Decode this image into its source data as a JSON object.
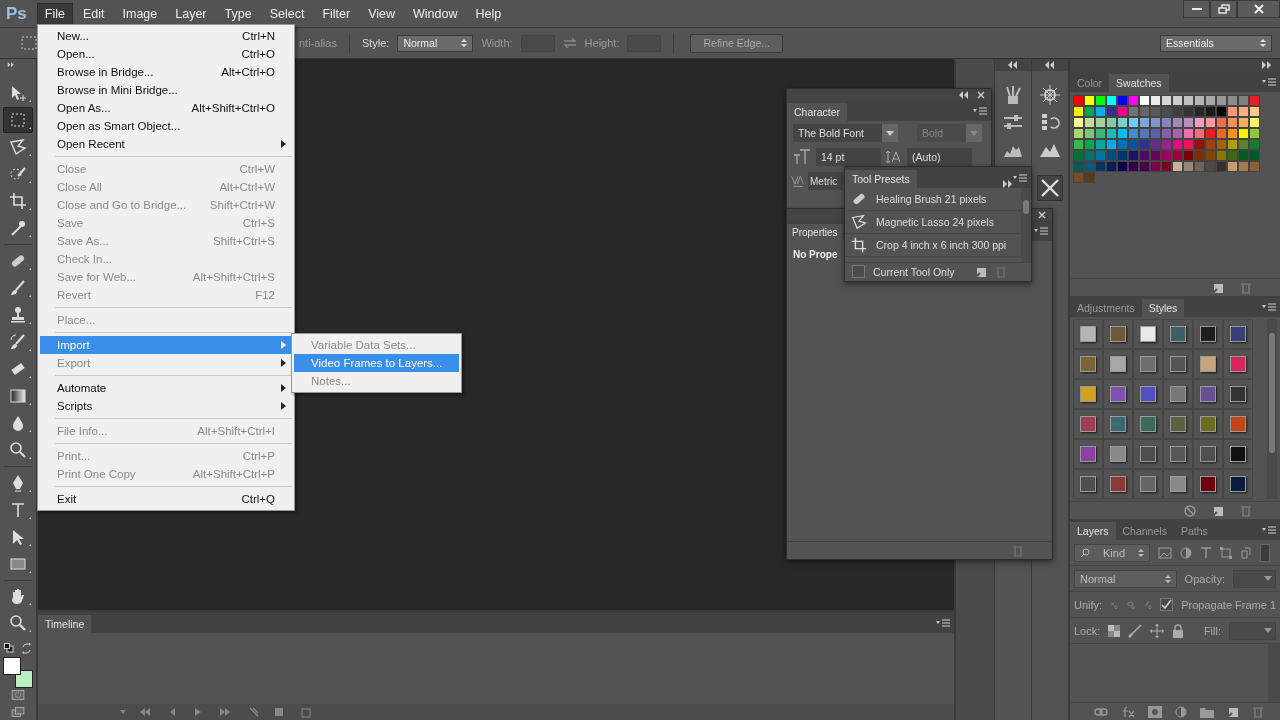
{
  "app": {
    "logo": "Ps"
  },
  "menubar": [
    {
      "label": "File",
      "selected": true
    },
    {
      "label": "Edit",
      "selected": false
    },
    {
      "label": "Image",
      "selected": false
    },
    {
      "label": "Layer",
      "selected": false
    },
    {
      "label": "Type",
      "selected": false
    },
    {
      "label": "Select",
      "selected": false
    },
    {
      "label": "Filter",
      "selected": false
    },
    {
      "label": "View",
      "selected": false
    },
    {
      "label": "Window",
      "selected": false
    },
    {
      "label": "Help",
      "selected": false
    }
  ],
  "options_bar": {
    "antialias_label": "nti-alias",
    "style_label": "Style:",
    "style_value": "Normal",
    "width_label": "Width:",
    "height_label": "Height:",
    "refine_button": "Refine Edge...",
    "workspace": "Essentials"
  },
  "tool_groups": [
    {
      "tools": [
        {
          "kind": "move",
          "selected": false
        },
        {
          "kind": "marquee",
          "selected": true
        },
        {
          "kind": "lasso",
          "selected": false
        },
        {
          "kind": "quick-select",
          "selected": false
        },
        {
          "kind": "crop",
          "selected": false
        },
        {
          "kind": "eyedropper",
          "selected": false
        }
      ]
    },
    {
      "tools": [
        {
          "kind": "healing",
          "selected": false
        },
        {
          "kind": "brush",
          "selected": false
        },
        {
          "kind": "stamp",
          "selected": false
        },
        {
          "kind": "history-brush",
          "selected": false
        },
        {
          "kind": "eraser",
          "selected": false
        },
        {
          "kind": "gradient",
          "selected": false
        },
        {
          "kind": "blur",
          "selected": false
        },
        {
          "kind": "dodge",
          "selected": false
        }
      ]
    },
    {
      "tools": [
        {
          "kind": "pen",
          "selected": false
        },
        {
          "kind": "type",
          "selected": false
        },
        {
          "kind": "path-select",
          "selected": false
        },
        {
          "kind": "rectangle",
          "selected": false
        }
      ]
    },
    {
      "tools": [
        {
          "kind": "hand",
          "selected": false
        },
        {
          "kind": "zoom",
          "selected": false
        }
      ]
    }
  ],
  "color_chips": [
    {
      "kind": "foreground",
      "color": "#ffffff"
    },
    {
      "kind": "background",
      "color": "#b8f0c2"
    }
  ],
  "file_menu": [
    {
      "kind": "item",
      "label": "New...",
      "shortcut": "Ctrl+N",
      "submenu": false,
      "disabled": false,
      "selected": false
    },
    {
      "kind": "item",
      "label": "Open...",
      "shortcut": "Ctrl+O",
      "submenu": false,
      "disabled": false,
      "selected": false
    },
    {
      "kind": "item",
      "label": "Browse in Bridge...",
      "shortcut": "Alt+Ctrl+O",
      "submenu": false,
      "disabled": false,
      "selected": false
    },
    {
      "kind": "item",
      "label": "Browse in Mini Bridge...",
      "submenu": false,
      "disabled": false,
      "selected": false
    },
    {
      "kind": "item",
      "label": "Open As...",
      "shortcut": "Alt+Shift+Ctrl+O",
      "submenu": false,
      "disabled": false,
      "selected": false
    },
    {
      "kind": "item",
      "label": "Open as Smart Object...",
      "submenu": false,
      "disabled": false,
      "selected": false
    },
    {
      "kind": "item",
      "label": "Open Recent",
      "submenu": true,
      "disabled": false,
      "selected": false
    },
    {
      "kind": "separator"
    },
    {
      "kind": "item",
      "label": "Close",
      "shortcut": "Ctrl+W",
      "submenu": false,
      "disabled": true,
      "selected": false
    },
    {
      "kind": "item",
      "label": "Close All",
      "shortcut": "Alt+Ctrl+W",
      "submenu": false,
      "disabled": true,
      "selected": false
    },
    {
      "kind": "item",
      "label": "Close and Go to Bridge...",
      "shortcut": "Shift+Ctrl+W",
      "submenu": false,
      "disabled": true,
      "selected": false
    },
    {
      "kind": "item",
      "label": "Save",
      "shortcut": "Ctrl+S",
      "submenu": false,
      "disabled": true,
      "selected": false
    },
    {
      "kind": "item",
      "label": "Save As...",
      "shortcut": "Shift+Ctrl+S",
      "submenu": false,
      "disabled": true,
      "selected": false
    },
    {
      "kind": "item",
      "label": "Check In...",
      "submenu": false,
      "disabled": true,
      "selected": false
    },
    {
      "kind": "item",
      "label": "Save for Web...",
      "shortcut": "Alt+Shift+Ctrl+S",
      "submenu": false,
      "disabled": true,
      "selected": false
    },
    {
      "kind": "item",
      "label": "Revert",
      "shortcut": "F12",
      "submenu": false,
      "disabled": true,
      "selected": false
    },
    {
      "kind": "separator"
    },
    {
      "kind": "item",
      "label": "Place...",
      "submenu": false,
      "disabled": true,
      "selected": false
    },
    {
      "kind": "separator"
    },
    {
      "kind": "item",
      "label": "Import",
      "submenu": true,
      "disabled": false,
      "selected": true
    },
    {
      "kind": "item",
      "label": "Export",
      "submenu": true,
      "disabled": true,
      "selected": false
    },
    {
      "kind": "separator"
    },
    {
      "kind": "item",
      "label": "Automate",
      "submenu": true,
      "disabled": false,
      "selected": false
    },
    {
      "kind": "item",
      "label": "Scripts",
      "submenu": true,
      "disabled": false,
      "selected": false
    },
    {
      "kind": "separator"
    },
    {
      "kind": "item",
      "label": "File Info...",
      "shortcut": "Alt+Shift+Ctrl+I",
      "submenu": false,
      "disabled": true,
      "selected": false
    },
    {
      "kind": "separator"
    },
    {
      "kind": "item",
      "label": "Print...",
      "shortcut": "Ctrl+P",
      "submenu": false,
      "disabled": true,
      "selected": false
    },
    {
      "kind": "item",
      "label": "Print One Copy",
      "shortcut": "Alt+Shift+Ctrl+P",
      "submenu": false,
      "disabled": true,
      "selected": false
    },
    {
      "kind": "separator"
    },
    {
      "kind": "item",
      "label": "Exit",
      "shortcut": "Ctrl+Q",
      "submenu": false,
      "disabled": false,
      "selected": false
    }
  ],
  "import_submenu": [
    {
      "label": "Variable Data Sets...",
      "disabled": true,
      "selected": false
    },
    {
      "label": "Video Frames to Layers...",
      "disabled": false,
      "selected": true
    },
    {
      "label": "Notes...",
      "disabled": true,
      "selected": false
    }
  ],
  "character_panel": {
    "tab": "Character",
    "font_family": "The Bold Font",
    "font_style": "Bold",
    "size": "14 pt",
    "leading": "(Auto)",
    "kerning": "Metric"
  },
  "properties_panel": {
    "tab": "Properties",
    "message": "No Prope"
  },
  "tool_presets": {
    "tab": "Tool Presets",
    "items": [
      {
        "kind": "healing",
        "label": "Healing Brush 21 pixels"
      },
      {
        "kind": "lasso",
        "label": "Magnetic Lasso 24 pixels"
      },
      {
        "kind": "crop",
        "label": "Crop 4 inch x 6 inch 300 ppi"
      }
    ],
    "current_tool_only": {
      "label": "Current Tool Only",
      "checked": false
    }
  },
  "swatches_panel": {
    "tabs": [
      {
        "label": "Color",
        "selected": false
      },
      {
        "label": "Swatches",
        "selected": true
      }
    ],
    "swatches": [
      {
        "color": "#ff0000"
      },
      {
        "color": "#ffff00"
      },
      {
        "color": "#00ff00"
      },
      {
        "color": "#00ffff"
      },
      {
        "color": "#0000ff"
      },
      {
        "color": "#ff00ff"
      },
      {
        "color": "#ffffff"
      },
      {
        "color": "#ebebeb"
      },
      {
        "color": "#d6d6d6"
      },
      {
        "color": "#cccccc"
      },
      {
        "color": "#c0c0c0"
      },
      {
        "color": "#b3b3b3"
      },
      {
        "color": "#a6a6a6"
      },
      {
        "color": "#999999"
      },
      {
        "color": "#8c8c8c"
      },
      {
        "color": "#808080"
      },
      {
        "color": "#ed1c24"
      },
      {
        "color": "#fff200"
      },
      {
        "color": "#00a650"
      },
      {
        "color": "#00aeef"
      },
      {
        "color": "#2e3192"
      },
      {
        "color": "#ec008c"
      },
      {
        "color": "#737373"
      },
      {
        "color": "#666666"
      },
      {
        "color": "#595959"
      },
      {
        "color": "#4d4d4d"
      },
      {
        "color": "#404040"
      },
      {
        "color": "#333333"
      },
      {
        "color": "#262626"
      },
      {
        "color": "#1a1a1a"
      },
      {
        "color": "#000000"
      },
      {
        "color": "#f7977a"
      },
      {
        "color": "#f9ad81"
      },
      {
        "color": "#fdc68a"
      },
      {
        "color": "#fff79a"
      },
      {
        "color": "#c4df9b"
      },
      {
        "color": "#a3d39c"
      },
      {
        "color": "#82ca9d"
      },
      {
        "color": "#7bcdc8"
      },
      {
        "color": "#6ecff6"
      },
      {
        "color": "#7ea7d8"
      },
      {
        "color": "#8493ca"
      },
      {
        "color": "#8882be"
      },
      {
        "color": "#a187be"
      },
      {
        "color": "#bc8dbf"
      },
      {
        "color": "#f49ac2"
      },
      {
        "color": "#f6989d"
      },
      {
        "color": "#f26c4f"
      },
      {
        "color": "#f68e55"
      },
      {
        "color": "#fbaf5c"
      },
      {
        "color": "#fff467"
      },
      {
        "color": "#acd372"
      },
      {
        "color": "#7cc576"
      },
      {
        "color": "#3bb878"
      },
      {
        "color": "#1abbb4"
      },
      {
        "color": "#00bff3"
      },
      {
        "color": "#438ccb"
      },
      {
        "color": "#5574b9"
      },
      {
        "color": "#605ca8"
      },
      {
        "color": "#855fa8"
      },
      {
        "color": "#a763a8"
      },
      {
        "color": "#f06ea9"
      },
      {
        "color": "#f26d7d"
      },
      {
        "color": "#ed1c24"
      },
      {
        "color": "#f26522"
      },
      {
        "color": "#f7941d"
      },
      {
        "color": "#fff200"
      },
      {
        "color": "#8dc63f"
      },
      {
        "color": "#39b54a"
      },
      {
        "color": "#00a651"
      },
      {
        "color": "#00a99d"
      },
      {
        "color": "#00aeef"
      },
      {
        "color": "#0072bc"
      },
      {
        "color": "#0054a6"
      },
      {
        "color": "#2e3192"
      },
      {
        "color": "#662d91"
      },
      {
        "color": "#92278f"
      },
      {
        "color": "#ec008c"
      },
      {
        "color": "#ed145b"
      },
      {
        "color": "#9e0b0f"
      },
      {
        "color": "#a0410d"
      },
      {
        "color": "#a36209"
      },
      {
        "color": "#aba000"
      },
      {
        "color": "#598527"
      },
      {
        "color": "#197b30"
      },
      {
        "color": "#007236"
      },
      {
        "color": "#00746b"
      },
      {
        "color": "#0076a3"
      },
      {
        "color": "#004b80"
      },
      {
        "color": "#003471"
      },
      {
        "color": "#1b1464"
      },
      {
        "color": "#440e62"
      },
      {
        "color": "#630460"
      },
      {
        "color": "#9e005d"
      },
      {
        "color": "#9e0039"
      },
      {
        "color": "#790000"
      },
      {
        "color": "#7b2e00"
      },
      {
        "color": "#7d4900"
      },
      {
        "color": "#827b00"
      },
      {
        "color": "#406618"
      },
      {
        "color": "#005e20"
      },
      {
        "color": "#005826"
      },
      {
        "color": "#005952"
      },
      {
        "color": "#005b7f"
      },
      {
        "color": "#003663"
      },
      {
        "color": "#002157"
      },
      {
        "color": "#0d004c"
      },
      {
        "color": "#32004b"
      },
      {
        "color": "#4b0049"
      },
      {
        "color": "#7b0046"
      },
      {
        "color": "#7a0026"
      },
      {
        "color": "#c7b299"
      },
      {
        "color": "#998675"
      },
      {
        "color": "#736357"
      },
      {
        "color": "#534741"
      },
      {
        "color": "#37302d"
      },
      {
        "color": "#c69c6d"
      },
      {
        "color": "#a67c52"
      },
      {
        "color": "#8c6239"
      },
      {
        "color": "#754c24"
      },
      {
        "color": "#603913"
      }
    ]
  },
  "styles_panel": {
    "tabs": [
      {
        "label": "Adjustments",
        "selected": false
      },
      {
        "label": "Styles",
        "selected": true
      }
    ],
    "styles": [
      {
        "color": "#b5b5b5"
      },
      {
        "color": "#6b5a35"
      },
      {
        "color": "#e8e8e8"
      },
      {
        "color": "#3e5f66"
      },
      {
        "color": "#1e1e1e"
      },
      {
        "color": "#3a3f7a"
      },
      {
        "color": "#7a6535"
      },
      {
        "color": "#a8a8a8"
      },
      {
        "color": "#6e6e6e"
      },
      {
        "color": "#555555"
      },
      {
        "color": "#c8a27a"
      },
      {
        "color": "#d8255a"
      },
      {
        "color": "#d0a022"
      },
      {
        "color": "#8050b0"
      },
      {
        "color": "#5050c0"
      },
      {
        "color": "#777777"
      },
      {
        "color": "#6a5090"
      },
      {
        "color": "#333333"
      },
      {
        "color": "#a04058"
      },
      {
        "color": "#3a6a70"
      },
      {
        "color": "#3a6a58"
      },
      {
        "color": "#5a6040"
      },
      {
        "color": "#6a6a20"
      },
      {
        "color": "#c04818"
      },
      {
        "color": "#8a40a0"
      },
      {
        "color": "#888888"
      },
      {
        "color": "#4e4e4e"
      },
      {
        "color": "#575757"
      },
      {
        "color": "#505050"
      },
      {
        "color": "#111111"
      },
      {
        "color": "#4f4f4f"
      },
      {
        "color": "#8a3a3a"
      },
      {
        "color": "#666666"
      },
      {
        "color": "#8a8a8a"
      },
      {
        "color": "#700010"
      },
      {
        "color": "#0a1a40"
      }
    ]
  },
  "layers_panel": {
    "tabs": [
      {
        "label": "Layers",
        "selected": true
      },
      {
        "label": "Channels",
        "selected": false
      },
      {
        "label": "Paths",
        "selected": false
      }
    ],
    "filter": "Kind",
    "blend_mode": "Normal",
    "opacity_label": "Opacity:",
    "unify_label": "Unify:",
    "propagate": {
      "label": "Propagate Frame 1",
      "checked": true
    },
    "lock_label": "Lock:",
    "fill_label": "Fill:"
  },
  "timeline": {
    "tab": "Timeline"
  }
}
